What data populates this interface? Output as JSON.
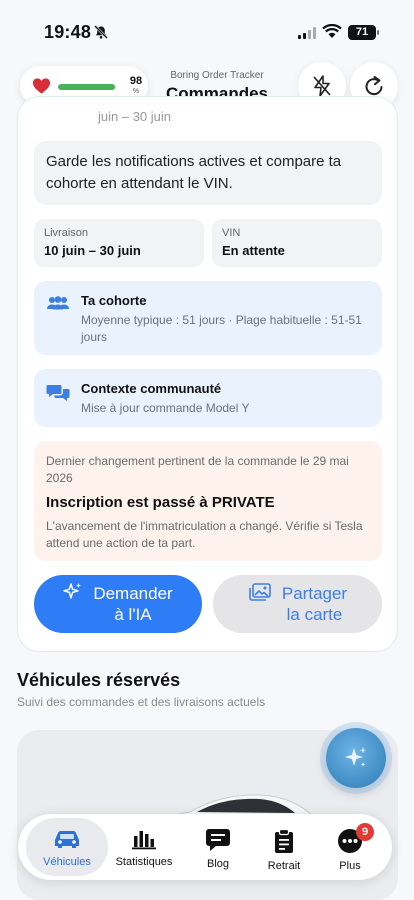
{
  "status_bar": {
    "time": "19:48",
    "battery": "71"
  },
  "header": {
    "health_value": "98",
    "health_unit": "%",
    "health_level": 0.98,
    "subtitle": "Boring Order Tracker",
    "title": "Commandes"
  },
  "card": {
    "peek_text": "juin – 30 juin",
    "notification": "Garde les notifications actives et compare ta cohorte en attendant le VIN.",
    "delivery": {
      "label": "Livraison",
      "value": "10 juin – 30 juin"
    },
    "vin": {
      "label": "VIN",
      "value": "En attente"
    },
    "cohort": {
      "title": "Ta cohorte",
      "desc": "Moyenne typique : 51 jours · Plage habituelle : 51-51 jours"
    },
    "community": {
      "title": "Contexte communauté",
      "desc": "Mise à jour commande Model Y"
    },
    "change": {
      "date_text": "Dernier changement pertinent de la commande le 29 mai 2026",
      "headline": "Inscription est passé à PRIVATE",
      "desc": "L'avancement de l'immatriculation a changé. Vérifie si Tesla attend une action de ta part."
    },
    "ask_ai_line1": "Demander",
    "ask_ai_line2": "à l'IA",
    "share_line1": "Partager",
    "share_line2": "la carte"
  },
  "section": {
    "title": "Véhicules réservés",
    "subtitle": "Suivi des commandes et des livraisons actuels"
  },
  "tabbar": {
    "tabs": [
      {
        "label": "Véhicules",
        "icon": "car-icon"
      },
      {
        "label": "Statistiques",
        "icon": "bar-chart-icon"
      },
      {
        "label": "Blog",
        "icon": "chat-bubble-icon"
      },
      {
        "label": "Retrait",
        "icon": "clipboard-icon"
      },
      {
        "label": "Plus",
        "icon": "more-icon"
      }
    ],
    "plus_badge": "9"
  },
  "colors": {
    "accent": "#2e7cf6",
    "health": "#49b15a",
    "badge": "#e53935"
  }
}
